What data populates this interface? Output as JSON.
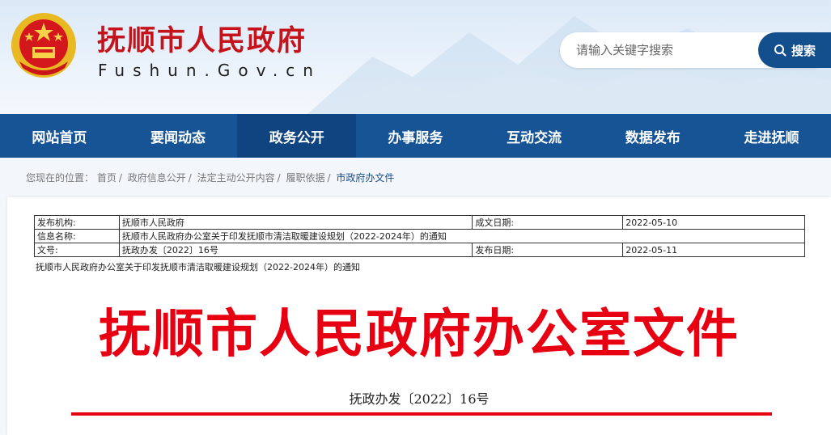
{
  "header": {
    "site_title": "抚顺市人民政府",
    "site_domain": "Fushun.Gov.cn",
    "search": {
      "placeholder": "请输入关键字搜索",
      "button_label": "搜索"
    }
  },
  "nav": {
    "items": [
      {
        "label": "网站首页"
      },
      {
        "label": "要闻动态"
      },
      {
        "label": "政务公开"
      },
      {
        "label": "办事服务"
      },
      {
        "label": "互动交流"
      },
      {
        "label": "数据发布"
      },
      {
        "label": "走进抚顺"
      }
    ],
    "active_index": 2
  },
  "breadcrumb": {
    "prefix": "您现在的位置：",
    "items": [
      "首页",
      "政府信息公开",
      "法定主动公开内容",
      "履职依据",
      "市政府办文件"
    ]
  },
  "meta": {
    "publisher_label": "发布机构:",
    "publisher_value": "抚顺市人民政府",
    "created_label": "成文日期:",
    "created_value": "2022-05-10",
    "name_label": "信息名称:",
    "name_value": "抚顺市人民政府办公室关于印发抚顺市清洁取暖建设规划（2022-2024年）的通知",
    "doc_label": "文号:",
    "doc_value": "抚政办发〔2022〕16号",
    "published_label": "发布日期:",
    "published_value": "2022-05-11"
  },
  "document": {
    "subject_line": "抚顺市人民政府办公室关于印发抚顺市清洁取暖建设规划（2022-2024年）的通知",
    "red_title": "抚顺市人民政府办公室文件",
    "doc_number": "抚政办发〔2022〕16号"
  },
  "colors": {
    "brand_red": "#c4131a",
    "nav_blue": "#165495",
    "doc_red": "#e60012"
  }
}
